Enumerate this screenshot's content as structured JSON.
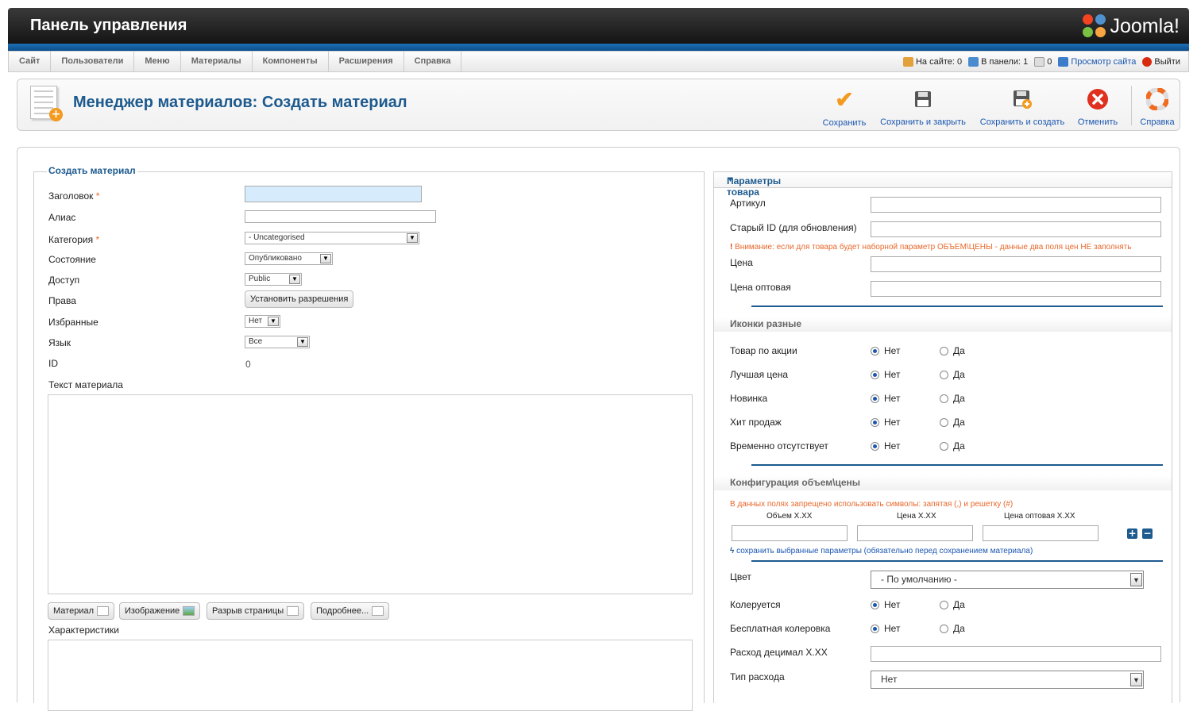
{
  "header": {
    "title": "Панель управления",
    "logo_text": "Joomla!"
  },
  "menu": {
    "items": [
      "Сайт",
      "Пользователи",
      "Меню",
      "Материалы",
      "Компоненты",
      "Расширения",
      "Справка"
    ]
  },
  "status": {
    "on_site": "На сайте: 0",
    "in_panel": "В панели: 1",
    "messages": "0",
    "view_site": "Просмотр сайта",
    "logout": "Выйти"
  },
  "page": {
    "title": "Менеджер материалов: Создать материал"
  },
  "toolbar": {
    "save": "Сохранить",
    "save_close": "Сохранить и закрыть",
    "save_new": "Сохранить и создать",
    "cancel": "Отменить",
    "help": "Справка"
  },
  "form": {
    "legend": "Создать материал",
    "title_label": "Заголовок",
    "alias_label": "Алиас",
    "category_label": "Категория",
    "category_value": "- Uncategorised",
    "state_label": "Состояние",
    "state_value": "Опубликовано",
    "access_label": "Доступ",
    "access_value": "Public",
    "rights_label": "Права",
    "rights_button": "Установить разрешения",
    "featured_label": "Избранные",
    "featured_value": "Нет",
    "language_label": "Язык",
    "language_value": "Все",
    "id_label": "ID",
    "id_value": "0",
    "text_label": "Текст материала",
    "btn_article": "Материал",
    "btn_image": "Изображение",
    "btn_pagebreak": "Разрыв страницы",
    "btn_readmore": "Подробнее...",
    "specs_label": "Характеристики"
  },
  "params": {
    "title": "Параметры товара",
    "sku_label": "Артикул",
    "old_id_label": "Старый ID (для обновления)",
    "warning": "Внимание: если для товара будет наборной параметр ОБЪЕМ\\ЦЕНЫ - данные два поля цен НЕ заполнять",
    "price_label": "Цена",
    "wholesale_label": "Цена оптовая",
    "icons_section": "Иконки разные",
    "no": "Нет",
    "yes": "Да",
    "icon_rows": [
      "Товар по акции",
      "Лучшая цена",
      "Новинка",
      "Хит продаж",
      "Временно отсутствует"
    ],
    "config_section": "Конфигурация объем\\цены",
    "config_warning": "В данных полях запрещено использовать символы: запятая (,) и решетку (#)",
    "col_volume": "Объем X.XX",
    "col_price": "Цена X.XX",
    "col_wholesale": "Цена оптовая X.XX",
    "save_link": "сохранить выбранные параметры (обязательно перед сохранением материала)",
    "color_label": "Цвет",
    "color_value": "- По умолчанию -",
    "tinted_label": "Колеруется",
    "free_tint_label": "Бесплатная колеровка",
    "consumption_label": "Расход децимал X.XX",
    "consumption_type_label": "Тип расхода",
    "consumption_type_value": "Нет"
  },
  "colors": {
    "accent": "#1d5a8e",
    "link": "#1b57b1",
    "warning": "#e8682c"
  }
}
